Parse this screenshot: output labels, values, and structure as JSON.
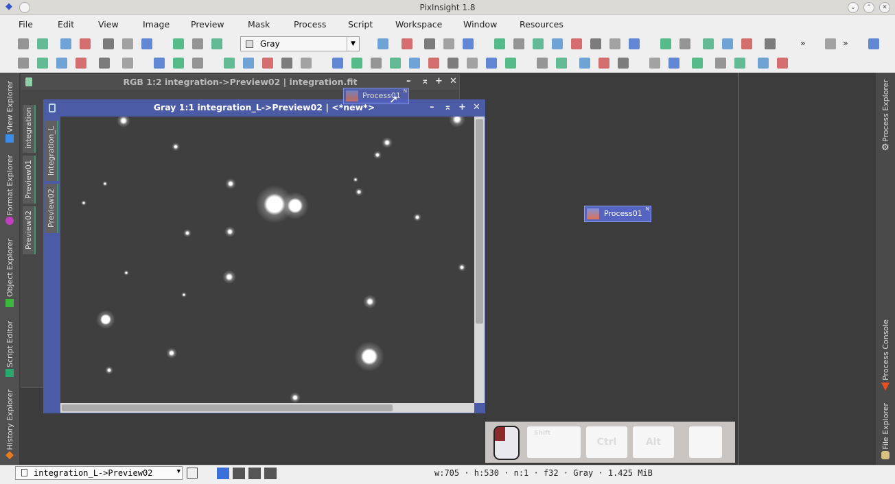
{
  "window": {
    "title": "PixInsight 1.8"
  },
  "menu": [
    "File",
    "Edit",
    "View",
    "Image",
    "Preview",
    "Mask",
    "Process",
    "Script",
    "Workspace",
    "Window",
    "Resources"
  ],
  "toolbar": {
    "colorspace_select": "Gray",
    "overflow": "»"
  },
  "left_panel": [
    "View Explorer",
    "Format Explorer",
    "Object Explorer",
    "Script Editor",
    "History Explorer"
  ],
  "right_panel": [
    "Process Explorer",
    "Process Console",
    "File Explorer"
  ],
  "rgb_window": {
    "title": "RGB 1:2 integration->Preview02 | integration.fit",
    "tabs": [
      "integration",
      "Preview01",
      "Preview02"
    ]
  },
  "gray_window": {
    "title": "Gray 1:1 integration_L->Preview02 | <*new*>",
    "tabs": [
      "integration_L",
      "Preview02"
    ]
  },
  "process_icons": [
    {
      "label": "Process01"
    },
    {
      "label": "Process01"
    }
  ],
  "icon_badge": "N",
  "keys": {
    "shift": "Shift",
    "ctrl": "Ctrl",
    "alt": "Alt"
  },
  "status": {
    "view": "integration_L->Preview02",
    "info": "w:705 · h:530 · n:1 · f32 · Gray · 1.425 MiB"
  },
  "colors": {
    "active_window": "#4c5ba5",
    "workspace": "#3c3c3c",
    "process_icon": "#5464c0"
  }
}
